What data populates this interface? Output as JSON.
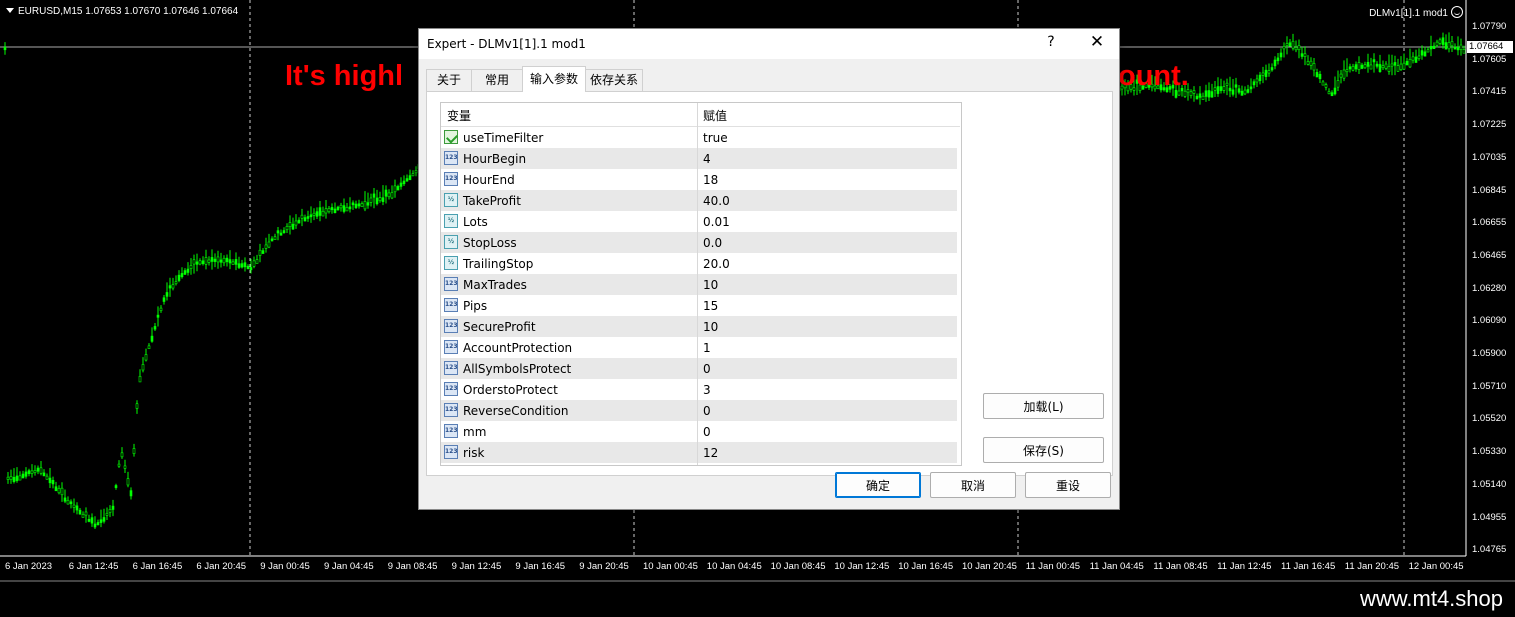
{
  "chart": {
    "symbol_info": "EURUSD,M15  1.07653 1.07670 1.07646 1.07664",
    "ea_label": "DLMv1[1].1 mod1",
    "current_price": "1.07664",
    "price_ticks": [
      "1.07790",
      "1.07605",
      "1.07415",
      "1.07225",
      "1.07035",
      "1.06845",
      "1.06655",
      "1.06465",
      "1.06280",
      "1.06090",
      "1.05900",
      "1.05710",
      "1.05520",
      "1.05330",
      "1.05140",
      "1.04955",
      "1.04765"
    ],
    "time_ticks": [
      "6 Jan 2023",
      "6 Jan 12:45",
      "6 Jan 16:45",
      "6 Jan 20:45",
      "9 Jan 00:45",
      "9 Jan 04:45",
      "9 Jan 08:45",
      "9 Jan 12:45",
      "9 Jan 16:45",
      "9 Jan 20:45",
      "10 Jan 00:45",
      "10 Jan 04:45",
      "10 Jan 08:45",
      "10 Jan 12:45",
      "10 Jan 16:45",
      "10 Jan 20:45",
      "11 Jan 00:45",
      "11 Jan 04:45",
      "11 Jan 08:45",
      "11 Jan 12:45",
      "11 Jan 16:45",
      "11 Jan 20:45",
      "12 Jan 00:45"
    ],
    "overlay_left": "It's highl",
    "overlay_right": "ount.",
    "colors": {
      "candle": "#00ff00",
      "overlay": "#ff0000",
      "background": "#000000"
    }
  },
  "dialog": {
    "title": "Expert - DLMv1[1].1 mod1",
    "help_label": "?",
    "close_label": "✕",
    "tabs": [
      {
        "label": "关于"
      },
      {
        "label": "常用"
      },
      {
        "label": "输入参数"
      },
      {
        "label": "依存关系"
      }
    ],
    "grid": {
      "header_variable": "变量",
      "header_value": "赋值",
      "rows": [
        {
          "variable": "useTimeFilter",
          "value": "true",
          "type": "bool"
        },
        {
          "variable": "HourBegin",
          "value": "4",
          "type": "int"
        },
        {
          "variable": "HourEnd",
          "value": "18",
          "type": "int"
        },
        {
          "variable": "TakeProfit",
          "value": "40.0",
          "type": "double"
        },
        {
          "variable": "Lots",
          "value": "0.01",
          "type": "double"
        },
        {
          "variable": "StopLoss",
          "value": "0.0",
          "type": "double"
        },
        {
          "variable": "TrailingStop",
          "value": "20.0",
          "type": "double"
        },
        {
          "variable": "MaxTrades",
          "value": "10",
          "type": "int"
        },
        {
          "variable": "Pips",
          "value": "15",
          "type": "int"
        },
        {
          "variable": "SecureProfit",
          "value": "10",
          "type": "int"
        },
        {
          "variable": "AccountProtection",
          "value": "1",
          "type": "int"
        },
        {
          "variable": "AllSymbolsProtect",
          "value": "0",
          "type": "int"
        },
        {
          "variable": "OrderstoProtect",
          "value": "3",
          "type": "int"
        },
        {
          "variable": "ReverseCondition",
          "value": "0",
          "type": "int"
        },
        {
          "variable": "mm",
          "value": "0",
          "type": "int"
        },
        {
          "variable": "risk",
          "value": "12",
          "type": "int"
        }
      ]
    },
    "buttons": {
      "load": "加载(L)",
      "save": "保存(S)",
      "ok": "确定",
      "cancel": "取消",
      "reset": "重设"
    }
  },
  "footer": {
    "url": "www.mt4.shop"
  }
}
